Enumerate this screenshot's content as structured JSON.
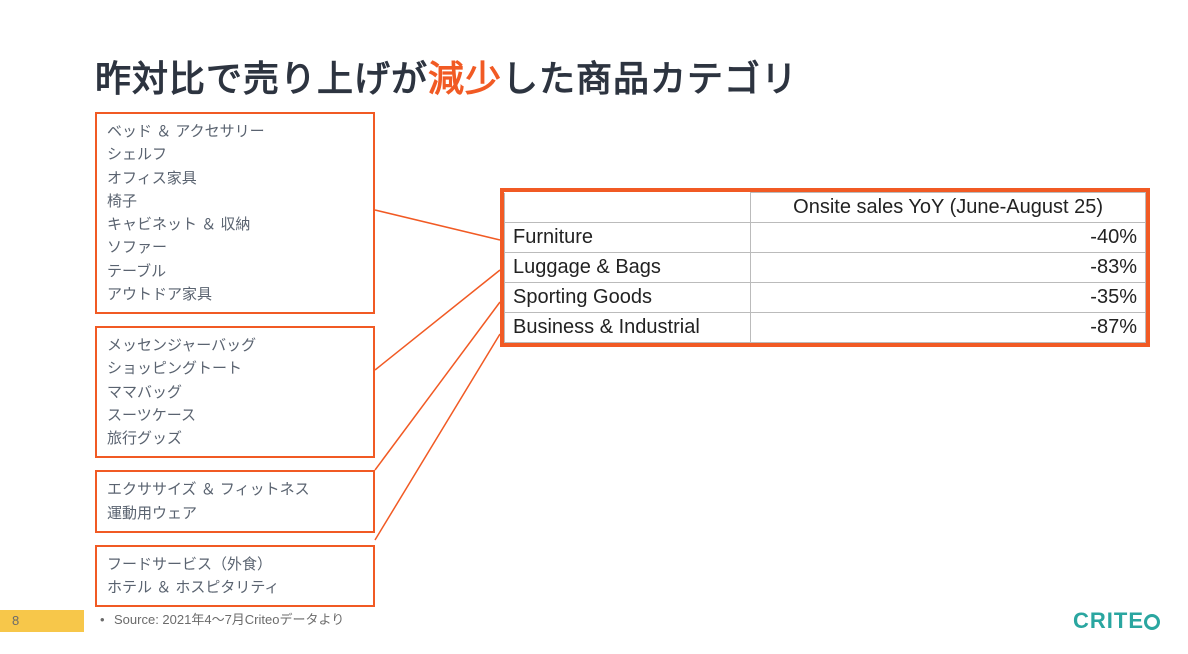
{
  "title_pre": "昨対比で売り上げが",
  "title_accent": "減少",
  "title_post": "した商品カテゴリ",
  "boxes": [
    [
      "ベッド ＆ アクセサリー",
      "シェルフ",
      "オフィス家具",
      "椅子",
      "キャビネット ＆ 収納",
      "ソファー",
      "テーブル",
      "アウトドア家具"
    ],
    [
      "メッセンジャーバッグ",
      "ショッピングトート",
      "ママバッグ",
      "スーツケース",
      "旅行グッズ"
    ],
    [
      "エクササイズ ＆ フィットネス",
      "運動用ウェア"
    ],
    [
      "フードサービス（外食）",
      "ホテル ＆ ホスピタリティ"
    ]
  ],
  "table": {
    "header_col2": "Onsite sales YoY (June-August 25)",
    "rows": [
      {
        "label": "Furniture",
        "value": "-40%"
      },
      {
        "label": "Luggage & Bags",
        "value": "-83%"
      },
      {
        "label": "Sporting Goods",
        "value": "-35%"
      },
      {
        "label": "Business & Industrial",
        "value": "-87%"
      }
    ]
  },
  "page_number": "8",
  "source_bullet": "•",
  "source_text": "Source: 2021年4～7月Criteoデータより",
  "logo_text_pre": "CRITE",
  "chart_data": {
    "type": "table",
    "title": "Onsite sales YoY (June-August 25)",
    "categories": [
      "Furniture",
      "Luggage & Bags",
      "Sporting Goods",
      "Business & Industrial"
    ],
    "values": [
      -40,
      -83,
      -35,
      -87
    ],
    "unit": "%"
  }
}
